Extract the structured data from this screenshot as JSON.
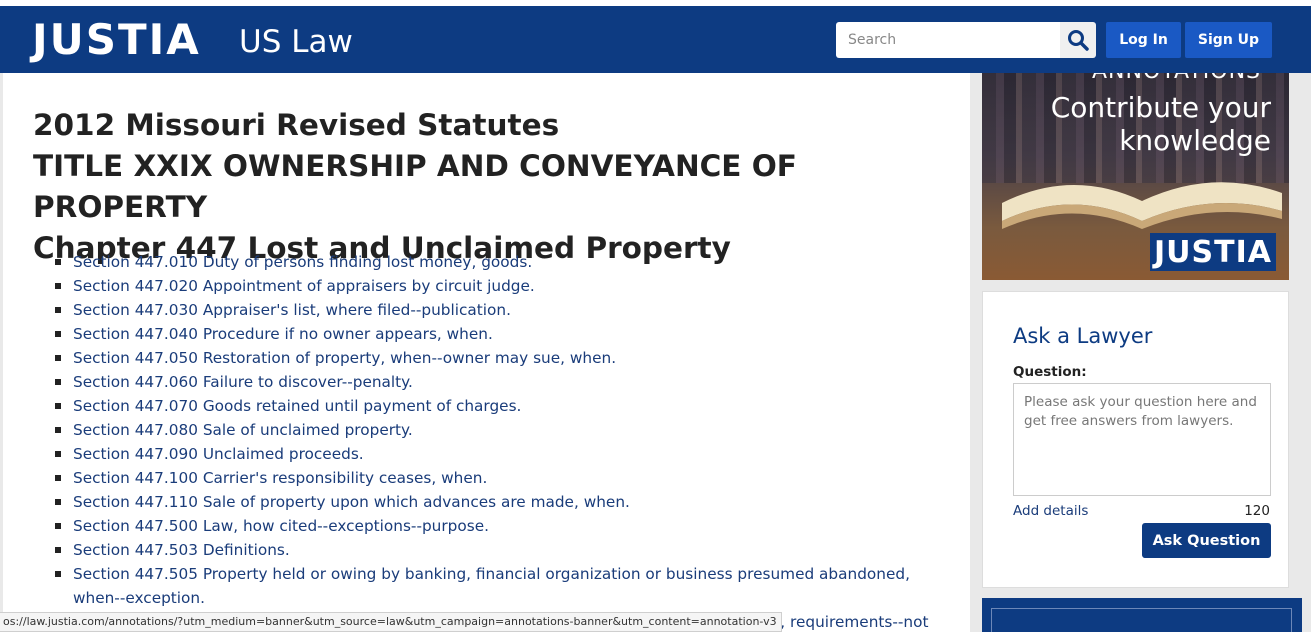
{
  "header": {
    "logo": "JUSTIA",
    "logo_sub": "US Law",
    "search_placeholder": "Search",
    "login_label": "Log In",
    "signup_label": "Sign Up",
    "color": "#0d3b82"
  },
  "main": {
    "title_line1": "2012 Missouri Revised Statutes",
    "title_line2": "TITLE XXIX OWNERSHIP AND CONVEYANCE OF PROPERTY",
    "title_line3": "Chapter 447 Lost and Unclaimed Property",
    "sections": [
      "Section 447.010 Duty of persons finding lost money, goods.",
      "Section 447.020 Appointment of appraisers by circuit judge.",
      "Section 447.030 Appraiser's list, where filed--publication.",
      "Section 447.040 Procedure if no owner appears, when.",
      "Section 447.050 Restoration of property, when--owner may sue, when.",
      "Section 447.060 Failure to discover--penalty.",
      "Section 447.070 Goods retained until payment of charges.",
      "Section 447.080 Sale of unclaimed property.",
      "Section 447.090 Unclaimed proceeds.",
      "Section 447.100 Carrier's responsibility ceases, when.",
      "Section 447.110 Sale of property upon which advances are made, when.",
      "Section 447.500 Law, how cited--exceptions--purpose.",
      "Section 447.503 Definitions.",
      "Section 447.505 Property held or owing by banking, financial organization or business presumed abandoned, when--exception."
    ],
    "partial_next_item": "posit, requirements--not"
  },
  "ad": {
    "line1": "ANNOTATIONS",
    "line2": "Contribute your",
    "line3": "knowledge",
    "brand": "JUSTIA"
  },
  "ask_lawyer": {
    "title": "Ask a Lawyer",
    "question_label": "Question:",
    "placeholder": "Please ask your question here and get free answers from lawyers.",
    "add_details": "Add details",
    "char_count": "120",
    "submit_label": "Ask Question"
  },
  "status_bar": {
    "url": "os://law.justia.com/annotations/?utm_medium=banner&utm_source=law&utm_campaign=annotations-banner&utm_content=annotation-v3"
  }
}
